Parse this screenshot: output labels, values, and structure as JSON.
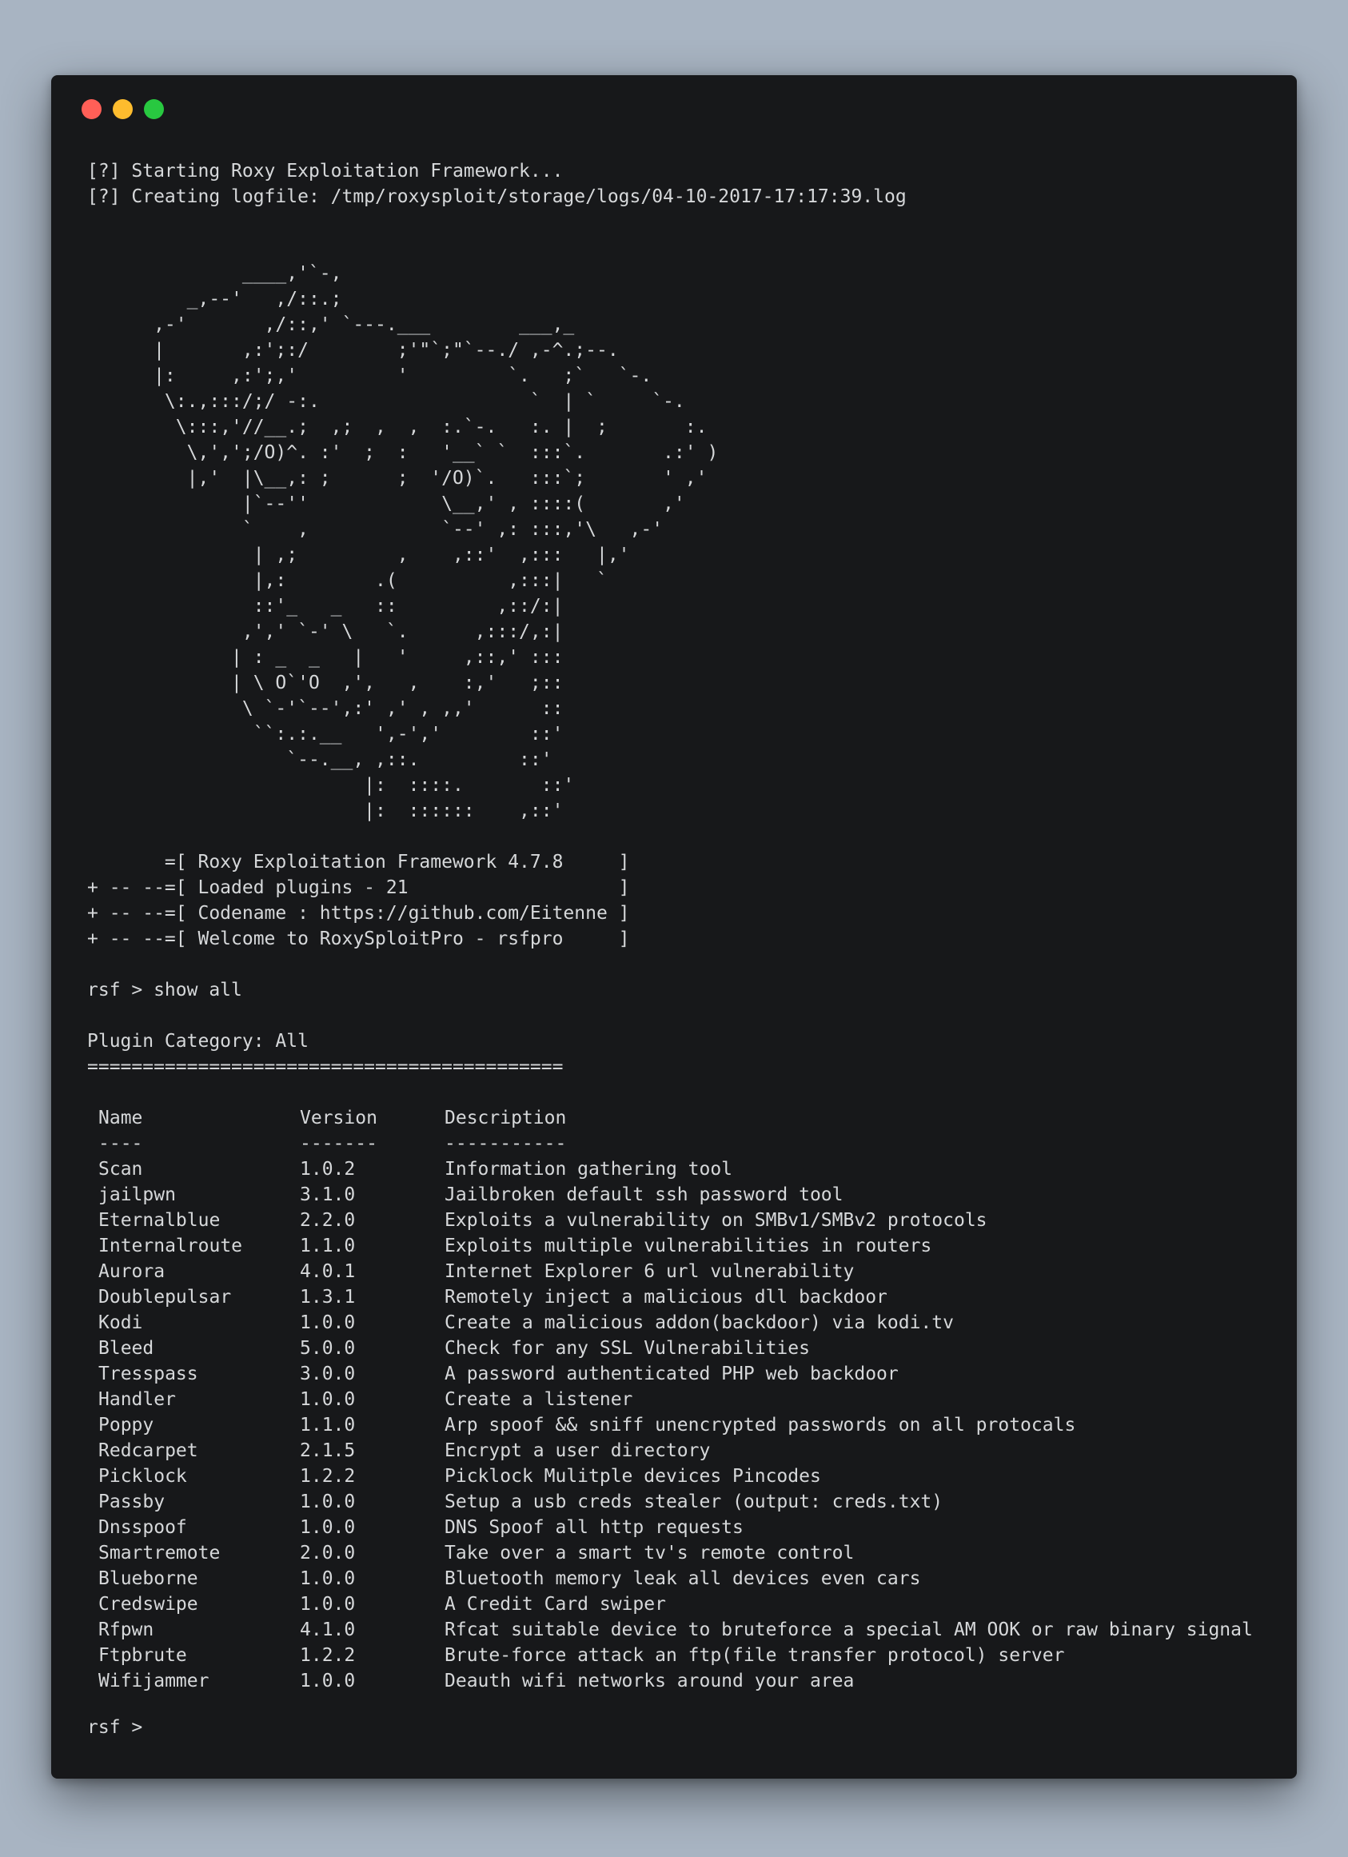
{
  "startup": {
    "line1": "[?] Starting Roxy Exploitation Framework...",
    "line2": "[?] Creating logfile: /tmp/roxysploit/storage/logs/04-10-2017-17:17:39.log"
  },
  "ascii_art": [
    "              ____,'`-,",
    "         _,--'   ,/::.;",
    "      ,-'       ,/::,' `---.___        ___,_",
    "      |       ,:';:/        ;'\"`;\"`--./ ,-^.;--.",
    "      |:     ,:';,'         '         `.   ;`   `-.",
    "       \\:.,:::/;/ -:.                   `  | `     `-.",
    "        \\:::,'//__.;  ,;  ,  ,  :.`-.   :. |  ;       :.",
    "         \\,',';/O)^. :'  ;  :   '__` `  :::`.       .:' )",
    "         |,'  |\\__,: ;      ;  '/O)`.   :::`;       ' ,'",
    "              |`--''            \\__,' , ::::(       ,'",
    "              `    ,            `--' ,: :::,'\\   ,-'",
    "               | ,;         ,    ,::'  ,:::   |,'",
    "               |,:        .(          ,:::|   `",
    "               ::'_   _   ::         ,::/:|",
    "              ,',' `-' \\   `.      ,:::/,:|",
    "             | : _  _   |   '     ,::,' :::",
    "             | \\ O`'O  ,',   ,    :,'   ;::",
    "              \\ `-'`--',:' ,' , ,,'      ::",
    "               ``:.:.__   ',-','        ::'",
    "                  `--.__, ,::.         ::'",
    "                         |:  ::::.       ::'",
    "                         |:  ::::::    ,::'"
  ],
  "banner": [
    "       =[ Roxy Exploitation Framework 4.7.8     ]",
    "+ -- --=[ Loaded plugins - 21                   ]",
    "+ -- --=[ Codename : https://github.com/Eitenne ]",
    "+ -- --=[ Welcome to RoxySploitPro - rsfpro     ]"
  ],
  "command": "rsf > show all",
  "category": {
    "title": "Plugin Category: All",
    "underline": "==========================================="
  },
  "table": {
    "headers": {
      "name": "Name",
      "version": "Version",
      "description": "Description"
    },
    "separators": {
      "name": "----",
      "version": "-------",
      "description": "-----------"
    },
    "rows": [
      {
        "name": "Scan",
        "version": "1.0.2",
        "description": "Information gathering tool"
      },
      {
        "name": "jailpwn",
        "version": "3.1.0",
        "description": "Jailbroken default ssh password tool"
      },
      {
        "name": "Eternalblue",
        "version": "2.2.0",
        "description": "Exploits a vulnerability on SMBv1/SMBv2 protocols"
      },
      {
        "name": "Internalroute",
        "version": "1.1.0",
        "description": "Exploits multiple vulnerabilities in routers"
      },
      {
        "name": "Aurora",
        "version": "4.0.1",
        "description": "Internet Explorer 6 url vulnerability"
      },
      {
        "name": "Doublepulsar",
        "version": "1.3.1",
        "description": "Remotely inject a malicious dll backdoor"
      },
      {
        "name": "Kodi",
        "version": "1.0.0",
        "description": "Create a malicious addon(backdoor) via kodi.tv"
      },
      {
        "name": "Bleed",
        "version": "5.0.0",
        "description": "Check for any SSL Vulnerabilities"
      },
      {
        "name": "Tresspass",
        "version": "3.0.0",
        "description": "A password authenticated PHP web backdoor"
      },
      {
        "name": "Handler",
        "version": "1.0.0",
        "description": "Create a listener"
      },
      {
        "name": "Poppy",
        "version": "1.1.0",
        "description": "Arp spoof && sniff unencrypted passwords on all protocals"
      },
      {
        "name": "Redcarpet",
        "version": "2.1.5",
        "description": "Encrypt a user directory"
      },
      {
        "name": "Picklock",
        "version": "1.2.2",
        "description": "Picklock Mulitple devices Pincodes"
      },
      {
        "name": "Passby",
        "version": "1.0.0",
        "description": "Setup a usb creds stealer (output: creds.txt)"
      },
      {
        "name": "Dnsspoof",
        "version": "1.0.0",
        "description": "DNS Spoof all http requests"
      },
      {
        "name": "Smartremote",
        "version": "2.0.0",
        "description": "Take over a smart tv's remote control"
      },
      {
        "name": "Blueborne",
        "version": "1.0.0",
        "description": "Bluetooth memory leak all devices even cars"
      },
      {
        "name": "Credswipe",
        "version": "1.0.0",
        "description": "A Credit Card swiper"
      },
      {
        "name": "Rfpwn",
        "version": "4.1.0",
        "description": "Rfcat suitable device to bruteforce a special AM OOK or raw binary signal"
      },
      {
        "name": "Ftpbrute",
        "version": "1.2.2",
        "description": "Brute-force attack an ftp(file transfer protocol) server"
      },
      {
        "name": "Wifijammer",
        "version": "1.0.0",
        "description": "Deauth wifi networks around your area"
      }
    ]
  },
  "final_prompt": "rsf > ",
  "colors": {
    "page_background": "#a8b4c2",
    "terminal_background": "#17181a",
    "text": "#d6d8da",
    "close_light": "#ff5f57",
    "minimize_light": "#febc2e",
    "zoom_light": "#28c840"
  }
}
